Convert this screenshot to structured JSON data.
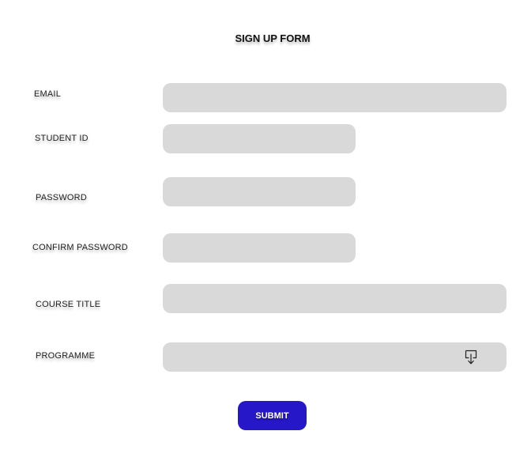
{
  "form": {
    "title": "SIGN UP FORM",
    "email_label": "EMAIL",
    "email_value": "",
    "student_id_label": "STUDENT ID",
    "student_id_value": "",
    "password_label": "PASSWORD",
    "password_value": "",
    "confirm_password_label": "CONFIRM PASSWORD",
    "confirm_password_value": "",
    "course_title_label": "COURSE TITLE",
    "course_title_value": "",
    "programme_label": "PROGRAMME",
    "programme_value": "",
    "programme_icon": "dropdown-arrow-icon",
    "submit_label": "SUBMIT"
  },
  "colors": {
    "field_background": "#d9d9d9",
    "submit_background": "#2618c9",
    "submit_text": "#ffffff"
  }
}
